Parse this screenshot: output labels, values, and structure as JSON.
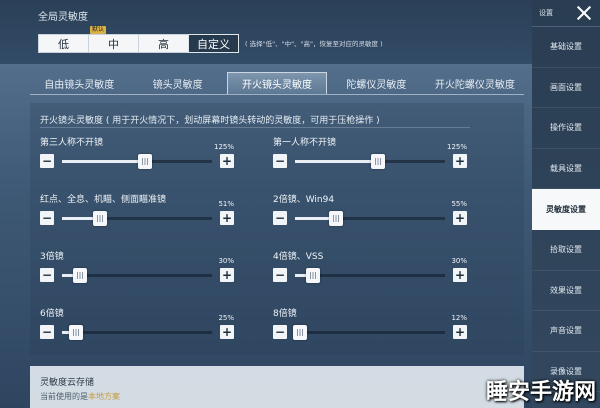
{
  "header": {
    "section_title": "全局灵敏度",
    "presets": [
      {
        "label": "低",
        "badge": "",
        "active": false
      },
      {
        "label": "中",
        "badge": "默认",
        "active": false
      },
      {
        "label": "高",
        "badge": "",
        "active": false
      },
      {
        "label": "自定义",
        "badge": "",
        "active": true
      }
    ],
    "hint": "( 选择\"低\"、\"中\"、\"高\"，恢复至对应的灵敏度 )"
  },
  "sidebar": {
    "header_label": "设置",
    "items": [
      {
        "label": "基础设置",
        "active": false
      },
      {
        "label": "画面设置",
        "active": false
      },
      {
        "label": "操作设置",
        "active": false
      },
      {
        "label": "载具设置",
        "active": false
      },
      {
        "label": "灵敏度设置",
        "active": true
      },
      {
        "label": "拾取设置",
        "active": false
      },
      {
        "label": "效果设置",
        "active": false
      },
      {
        "label": "声音设置",
        "active": false
      },
      {
        "label": "录像设置",
        "active": false
      }
    ]
  },
  "tabs": [
    {
      "label": "自由镜头灵敏度",
      "active": false
    },
    {
      "label": "镜头灵敏度",
      "active": false
    },
    {
      "label": "开火镜头灵敏度",
      "active": true
    },
    {
      "label": "陀螺仪灵敏度",
      "active": false
    },
    {
      "label": "开火陀螺仪灵敏度",
      "active": false
    }
  ],
  "panel": {
    "title": "开火镜头灵敏度 ( 用于开火情况下，划动屏幕时镜头转动的灵敏度，可用于压枪操作 )",
    "sliders": [
      {
        "label": "第三人称不开镜",
        "value_text": "125%",
        "fraction": 0.55
      },
      {
        "label": "第一人称不开镜",
        "value_text": "125%",
        "fraction": 0.55
      },
      {
        "label": "红点、全息、机瞄、侧面瞄准镜",
        "value_text": "51%",
        "fraction": 0.25
      },
      {
        "label": "2倍镜、Win94",
        "value_text": "55%",
        "fraction": 0.27
      },
      {
        "label": "3倍镜",
        "value_text": "30%",
        "fraction": 0.12
      },
      {
        "label": "4倍镜、VSS",
        "value_text": "30%",
        "fraction": 0.12
      },
      {
        "label": "6倍镜",
        "value_text": "25%",
        "fraction": 0.09
      },
      {
        "label": "8倍镜",
        "value_text": "12%",
        "fraction": 0.03
      }
    ],
    "minus": "−",
    "plus": "+"
  },
  "cloud": {
    "title": "灵敏度云存储",
    "current_prefix": "当前使用的是",
    "current_value": "本地方案"
  },
  "watermark": "睡安手游网"
}
